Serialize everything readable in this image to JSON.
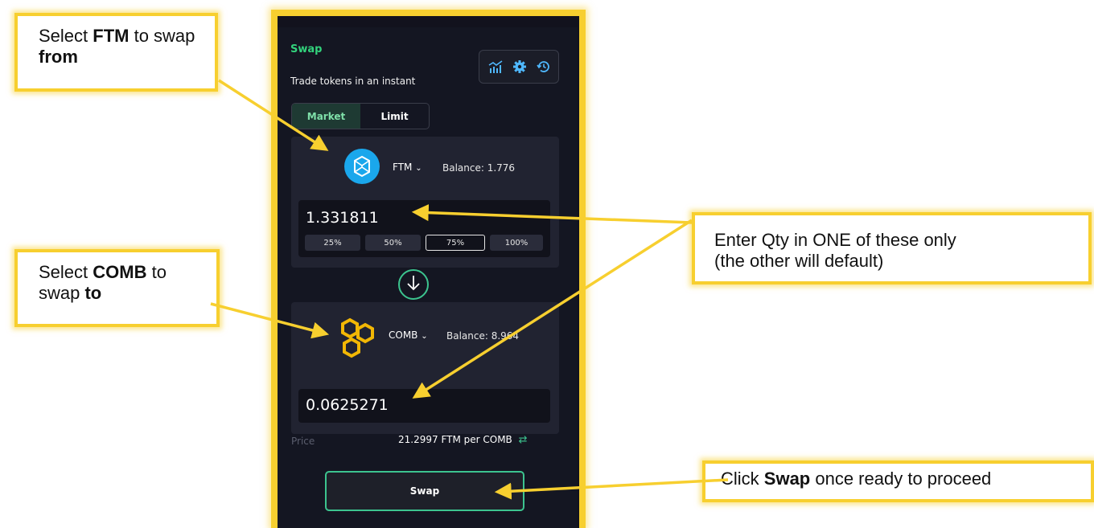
{
  "callouts": {
    "select_from": {
      "pre": "Select ",
      "token": "FTM",
      "mid": " to swap ",
      "word": "from"
    },
    "select_to": {
      "pre": "Select ",
      "token": "COMB",
      "mid": " to swap ",
      "word": "to"
    },
    "enter_qty": {
      "line1": "Enter Qty in ONE of these only",
      "line2": "(the other will default)"
    },
    "click_swap": {
      "pre": "Click ",
      "bold": "Swap",
      "post": " once ready to proceed"
    }
  },
  "widget": {
    "title": "Swap",
    "subtitle": "Trade tokens in an instant",
    "toolbar_icons": [
      "chart-icon",
      "gear-icon",
      "history-icon"
    ],
    "tabs": [
      {
        "label": "Market",
        "active": true
      },
      {
        "label": "Limit",
        "active": false
      }
    ],
    "from": {
      "symbol": "FTM",
      "balance": "Balance: 1.776",
      "amount": "1.331811",
      "percent_buttons": [
        "25%",
        "50%",
        "75%",
        "100%"
      ],
      "active_percent": "75%"
    },
    "to": {
      "symbol": "COMB",
      "balance": "Balance: 8.964",
      "amount": "0.0625271"
    },
    "price_label": "Price",
    "price_value": "21.2997 FTM per COMB",
    "swap_button": "Swap"
  },
  "colors": {
    "callout_border": "#f7cf2f",
    "accent_green": "#32d27c",
    "panel_bg": "#141622",
    "ftm_blue": "#1aa7ec",
    "comb_yellow": "#f2b705"
  }
}
